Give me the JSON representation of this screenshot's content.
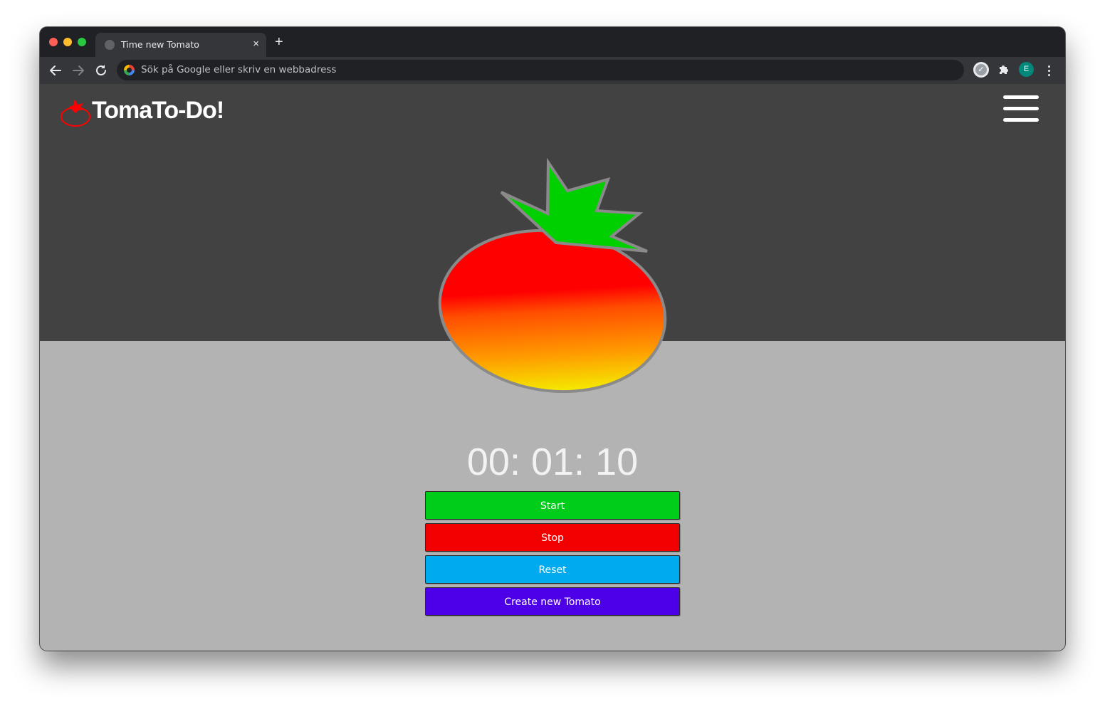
{
  "browser": {
    "tab_title": "Time new Tomato",
    "tab_close": "×",
    "new_tab": "+",
    "address_placeholder": "Sök på Google eller skriv en webbadress",
    "profile_initial": "E"
  },
  "app": {
    "brand": "TomaTo-Do!",
    "timer": "00: 01: 10",
    "buttons": {
      "start": "Start",
      "stop": "Stop",
      "reset": "Reset",
      "create": "Create new Tomato"
    },
    "colors": {
      "hero_bg": "#424242",
      "page_bg": "#b3b3b3",
      "start": "#00cc1a",
      "stop": "#f20000",
      "reset": "#00aaee",
      "create": "#4d00e8",
      "tomato_leaf": "#00d000",
      "tomato_top": "#ff0000",
      "tomato_bottom": "#f4f000"
    }
  }
}
